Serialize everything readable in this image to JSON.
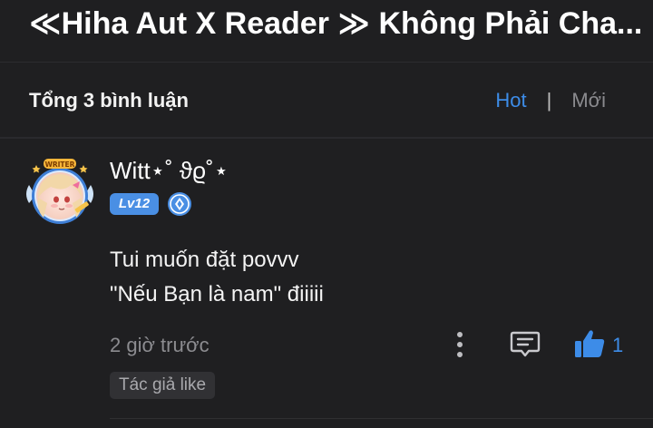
{
  "header": {
    "title": "≪Hiha Aut X Reader ≫ Không Phải Cha..."
  },
  "comments_header": {
    "total_label": "Tổng 3 bình luận",
    "sort_hot": "Hot",
    "sort_separator": "|",
    "sort_new": "Mới",
    "active_sort": "Hot"
  },
  "comment": {
    "username": "Witt⋆˚ ϑϱ˚⋆",
    "level": "Lv12",
    "avatar_badge": "WRITER",
    "lines": [
      "Tui muốn đặt povvv",
      "\"Nếu Bạn là nam\" điiiii"
    ],
    "time_ago": "2 giờ trước",
    "like_count": "1",
    "author_like_tag": "Tác giả like",
    "icons": {
      "more": "more-vertical-icon",
      "reply": "comment-reply-icon",
      "like": "thumbs-up-icon",
      "gem": "gem-badge-icon"
    }
  },
  "colors": {
    "background": "#1f1f21",
    "accent": "#3d8ce8",
    "level_badge": "#4a8fe4",
    "muted_text": "#8c8c90"
  }
}
